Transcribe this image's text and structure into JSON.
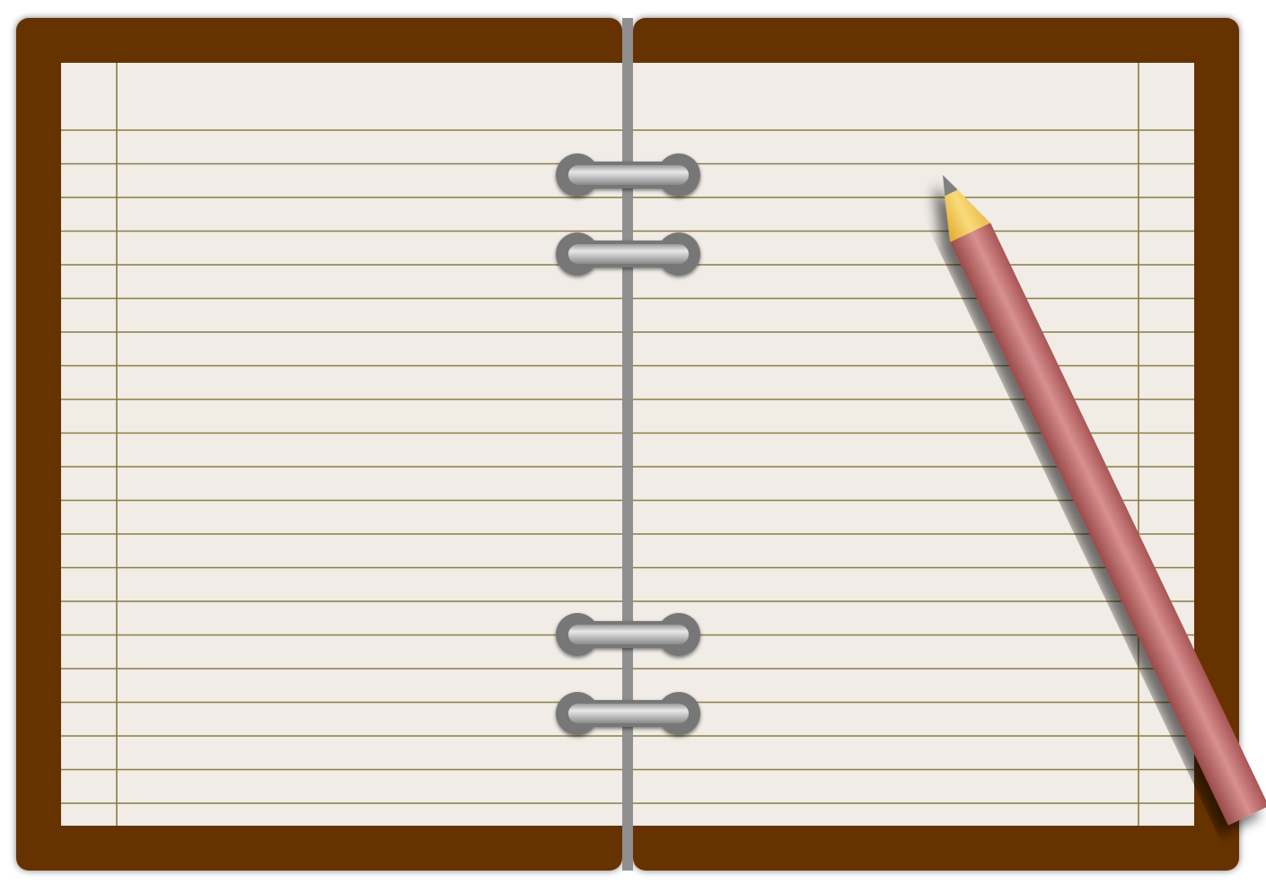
{
  "colors": {
    "cover": "#663300",
    "cover_shadow": "#7a7a7a",
    "paper": "#f1ece6",
    "rule_line": "#8b7d45",
    "spine": "#8f8f8f",
    "ring_outer": "#777777",
    "ring_highlight": "#e4e4e4",
    "pencil_body": "#c97a7a",
    "pencil_body_dark": "#9a4a4a",
    "pencil_wood": "#f2cc5a",
    "pencil_lead": "#808080"
  },
  "notebook": {
    "pages": [
      "left",
      "right"
    ],
    "rings_count": 4,
    "ruled_lines_per_page": 21,
    "margin_rule_side": [
      "left",
      "right"
    ]
  },
  "pencil": {
    "icon": "pencil-icon",
    "orientation": "diagonal"
  }
}
